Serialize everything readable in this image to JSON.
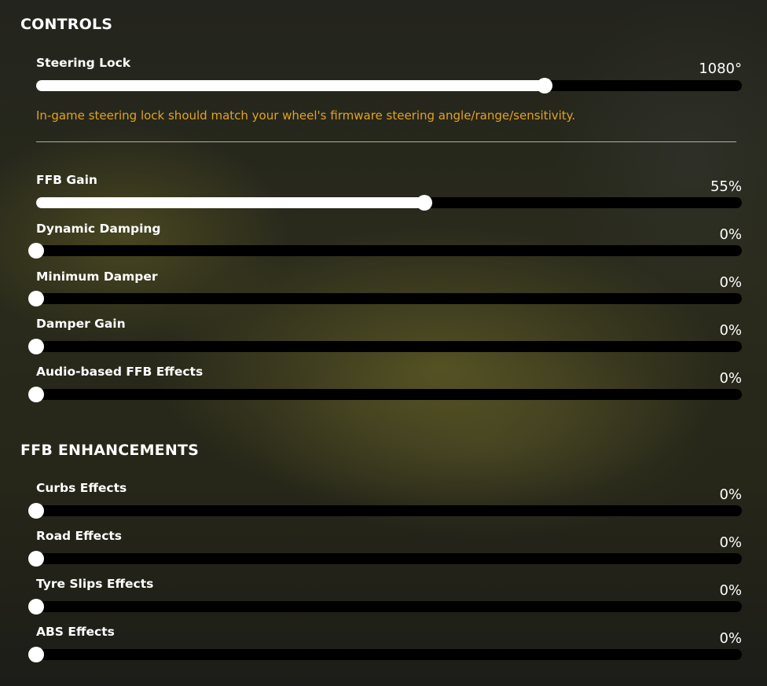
{
  "controls": {
    "title": "CONTROLS",
    "steering_lock": {
      "label": "Steering Lock",
      "value_text": "1080°",
      "fraction": 0.72
    },
    "hint": "In-game steering lock should match your wheel's firmware steering angle/range/sensitivity.",
    "sliders": [
      {
        "label": "FFB Gain",
        "value_text": "55%",
        "fraction": 0.55
      },
      {
        "label": "Dynamic Damping",
        "value_text": "0%",
        "fraction": 0
      },
      {
        "label": "Minimum Damper",
        "value_text": "0%",
        "fraction": 0
      },
      {
        "label": "Damper Gain",
        "value_text": "0%",
        "fraction": 0
      },
      {
        "label": "Audio-based FFB Effects",
        "value_text": "0%",
        "fraction": 0
      }
    ]
  },
  "ffb_enhancements": {
    "title": "FFB ENHANCEMENTS",
    "sliders": [
      {
        "label": "Curbs Effects",
        "value_text": "0%",
        "fraction": 0
      },
      {
        "label": "Road Effects",
        "value_text": "0%",
        "fraction": 0
      },
      {
        "label": "Tyre Slips Effects",
        "value_text": "0%",
        "fraction": 0
      },
      {
        "label": "ABS Effects",
        "value_text": "0%",
        "fraction": 0
      }
    ]
  },
  "colors": {
    "accent_hint": "#e3a21e",
    "track": "#000000",
    "fill": "#ffffff"
  }
}
